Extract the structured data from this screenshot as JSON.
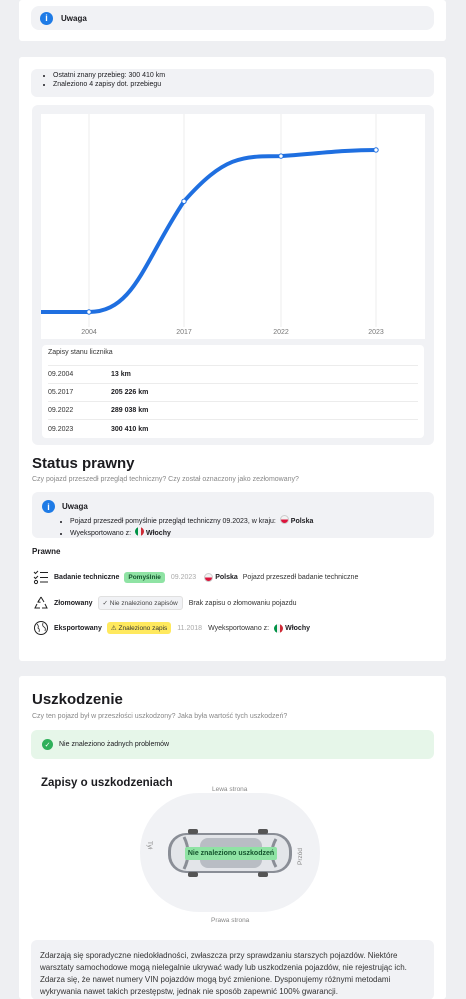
{
  "top_card": {
    "notice_title": "Uwaga"
  },
  "mileage_summary": [
    "Ostatni znany przebieg: 300 410 km",
    "Znaleziono 4 zapisy dot. przebiegu"
  ],
  "chart_data": {
    "type": "line",
    "x": [
      2004,
      2017,
      2022,
      2023
    ],
    "x_tick_labels": [
      "2004",
      "2017",
      "2022",
      "2023"
    ],
    "series": [
      {
        "values": [
          13,
          205226,
          289038,
          300410
        ]
      }
    ],
    "ylim": [
      0,
      330000
    ],
    "grid": "vertical",
    "color": "#1f6fe0"
  },
  "records": {
    "title": "Zapisy stanu licznika",
    "rows": [
      {
        "date": "09.2004",
        "value": "13 km"
      },
      {
        "date": "05.2017",
        "value": "205 226 km"
      },
      {
        "date": "09.2022",
        "value": "289 038 km"
      },
      {
        "date": "09.2023",
        "value": "300 410 km"
      }
    ]
  },
  "legal": {
    "title": "Status prawny",
    "question": "Czy pojazd przeszedł przegląd techniczny? Czy został oznaczony jako zezłomowany?",
    "notice_title": "Uwaga",
    "notice_line1_text": "Pojazd przeszedł pomyślnie przegląd techniczny 09.2023, w kraju:",
    "notice_line1_country": "Polska",
    "notice_line2_text": "Wyeksportowano z:",
    "notice_line2_country": "Włochy",
    "section_label": "Prawne",
    "rows": [
      {
        "name": "Badanie techniczne",
        "badge": "Pomyślnie",
        "date": "09.2023",
        "country": "Polska",
        "desc": "Pojazd przeszedł badanie techniczne"
      },
      {
        "name": "Złomowany",
        "badge": "Nie znaleziono zapisów",
        "desc": "Brak zapisu o złomowaniu pojazdu"
      },
      {
        "name": "Eksportowany",
        "badge": "Znaleziono zapis",
        "date": "11.2018",
        "desc": "Wyeksportowano z:",
        "country": "Włochy"
      }
    ]
  },
  "damage": {
    "title": "Uszkodzenie",
    "question": "Czy ten pojazd był w przeszłości uszkodzony? Jaka była wartość tych uszkodzeń?",
    "ok_text": "Nie znaleziono żadnych problemów",
    "records_title": "Zapisy o uszkodzeniach",
    "car_labels": {
      "left": "Lewa strona",
      "right": "Prawa strona",
      "front": "Przód",
      "rear": "Tył"
    },
    "car_status": "Nie znaleziono uszkodzeń",
    "disclaimer": "Zdarzają się sporadyczne niedokładności, zwłaszcza przy sprawdzaniu starszych pojazdów. Niektóre warsztaty samochodowe mogą nielegalnie ukrywać wady lub uszkodzenia pojazdów, nie rejestrując ich. Zdarza się, że nawet numery VIN pojazdów mogą być zmienione. Dysponujemy różnymi metodami wykrywania nawet takich przestępstw, jednak nie sposób zapewnić 100% gwarancji."
  }
}
